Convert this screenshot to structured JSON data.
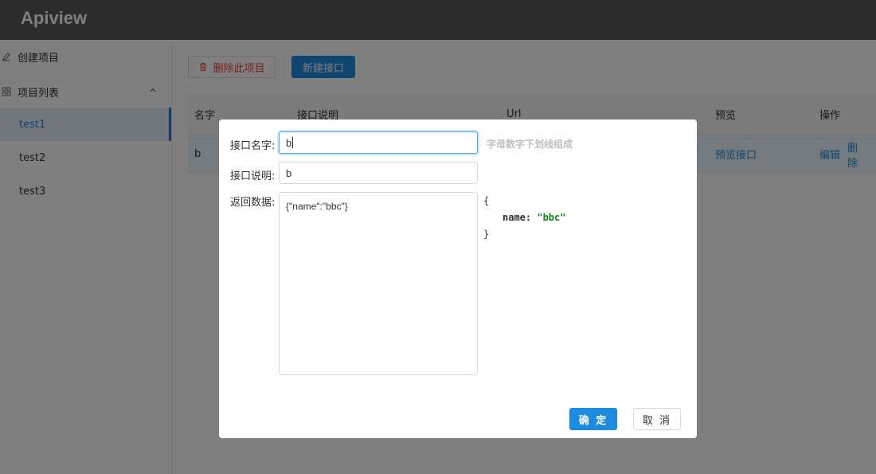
{
  "app": {
    "title": "Apiview"
  },
  "sidebar": {
    "create_label": "创建项目",
    "list_label": "项目列表",
    "projects": [
      {
        "name": "test1",
        "active": true
      },
      {
        "name": "test2",
        "active": false
      },
      {
        "name": "test3",
        "active": false
      }
    ]
  },
  "toolbar": {
    "delete_label": "删除此项目",
    "new_label": "新建接口"
  },
  "table": {
    "columns": [
      "名字",
      "接口说明",
      "Url",
      "预览",
      "操作"
    ],
    "rows": [
      {
        "name": "b",
        "preview": "预览接口",
        "edit": "编辑",
        "delete": "删除"
      }
    ]
  },
  "modal": {
    "name_label": "接口名字:",
    "name_value": "b",
    "name_hint": "字母数字下划线组成",
    "desc_label": "接口说明:",
    "desc_value": "b",
    "data_label": "返回数据:",
    "data_value": "{\"name\":\"bbc\"}",
    "preview": {
      "open": "{",
      "key": "name:",
      "value": "\"bbc\"",
      "close": "}"
    },
    "ok_label": "确 定",
    "cancel_label": "取 消"
  },
  "colors": {
    "primary": "#1d8ce0",
    "danger": "#f04134",
    "header": "#595959"
  }
}
